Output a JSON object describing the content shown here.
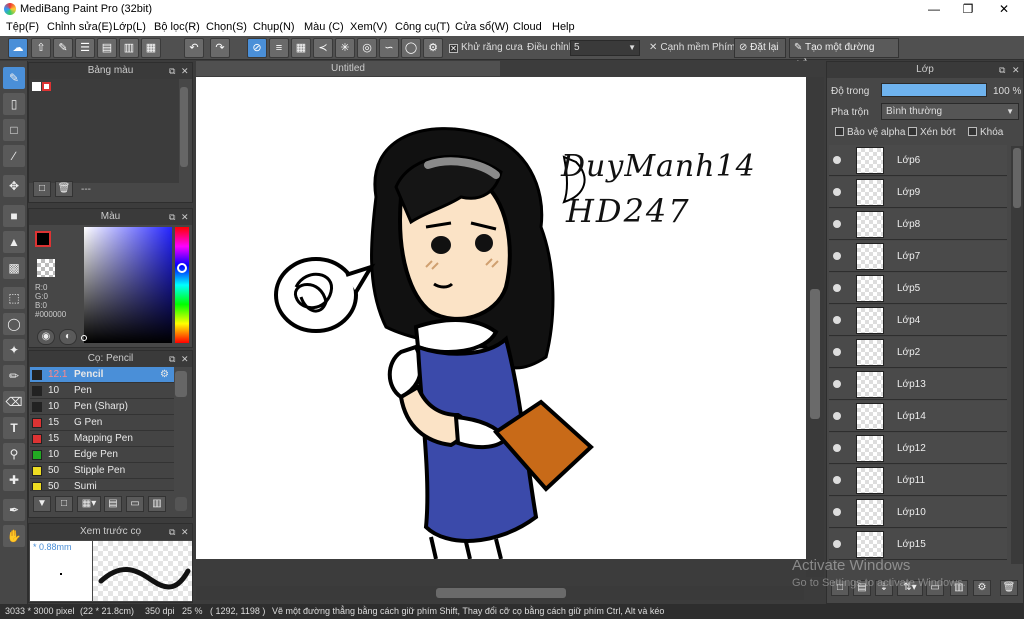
{
  "app": {
    "title": "MediBang Paint Pro (32bit)"
  },
  "menu": [
    "Tệp(F)",
    "Chỉnh sửa(E)",
    "Lớp(L)",
    "Bộ lọc(R)",
    "Chọn(S)",
    "Chụp(N)",
    "Màu (C)",
    "Xem(V)",
    "Công cụ(T)",
    "Cửa sổ(W)",
    "Cloud",
    "Help"
  ],
  "toolbar": {
    "antialias_label": "Khử răng cưa",
    "adjust_label": "Điều chỉnh",
    "adjust_value": "5",
    "smooth_label": "Cạnh mềm",
    "key_label": "Phím",
    "reset_label": "Đặt lại",
    "line_label": "Tạo một đường thẳng"
  },
  "panels": {
    "palette_title": "Bảng màu",
    "palette_footer": "---",
    "color_title": "Màu",
    "color_r": "R:0",
    "color_g": "G:0",
    "color_b": "B:0",
    "color_hex": "#000000",
    "brush_title": "Cọ: Pencil",
    "preview_title": "Xem trước cọ",
    "preview_size": "* 0.88mm"
  },
  "brushes": [
    {
      "size": "12.1",
      "name": "Pencil",
      "color": "#222222"
    },
    {
      "size": "10",
      "name": "Pen",
      "color": "#222222"
    },
    {
      "size": "10",
      "name": "Pen (Sharp)",
      "color": "#222222"
    },
    {
      "size": "15",
      "name": "G Pen",
      "color": "#dd3333"
    },
    {
      "size": "15",
      "name": "Mapping Pen",
      "color": "#dd3333"
    },
    {
      "size": "10",
      "name": "Edge Pen",
      "color": "#22aa22"
    },
    {
      "size": "50",
      "name": "Stipple Pen",
      "color": "#eedd22"
    },
    {
      "size": "50",
      "name": "Sumi",
      "color": "#eedd22"
    }
  ],
  "canvas": {
    "tab": "Untitled",
    "signature_line1": "DuyManh14",
    "signature_line2": "HD247"
  },
  "layers": {
    "title": "Lớp",
    "opacity_label": "Độ trong",
    "opacity_value": "100 %",
    "blend_label": "Pha trộn",
    "blend_value": "Bình thường",
    "protect_alpha": "Bảo vệ alpha",
    "clipping": "Xén bớt",
    "lock": "Khóa",
    "items": [
      "Lớp6",
      "Lớp9",
      "Lớp8",
      "Lớp7",
      "Lớp5",
      "Lớp4",
      "Lớp2",
      "Lớp13",
      "Lớp14",
      "Lớp12",
      "Lớp11",
      "Lớp10",
      "Lớp15"
    ]
  },
  "watermark": {
    "line1": "Activate Windows",
    "line2": "Go to Settings to activate Windows."
  },
  "status": {
    "size": "3033 * 3000 pixel",
    "dims": "(22 * 21.8cm)",
    "dpi": "350 dpi",
    "zoom": "25 %",
    "coords": "( 1292, 1198 )",
    "hint": "Vẽ một đường thẳng bằng cách giữ phím Shift, Thay đổi cỡ cọ bằng cách giữ phím Ctrl, Alt và kéo"
  }
}
